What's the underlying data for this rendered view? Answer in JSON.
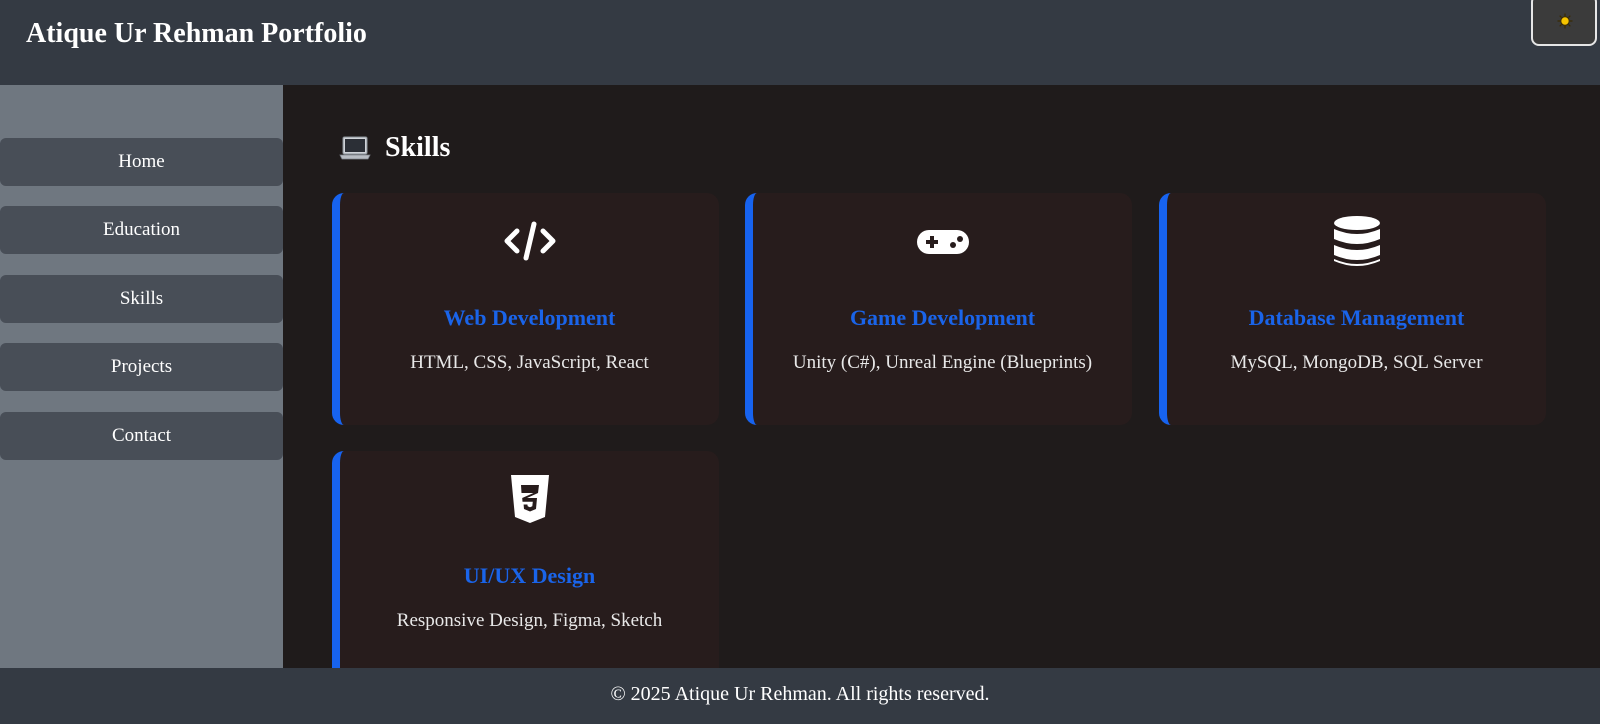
{
  "header": {
    "title": "Atique Ur Rehman Portfolio",
    "theme_toggle_icon": "sun-icon"
  },
  "sidebar": {
    "items": [
      {
        "label": "Home"
      },
      {
        "label": "Education"
      },
      {
        "label": "Skills"
      },
      {
        "label": "Projects"
      },
      {
        "label": "Contact"
      }
    ]
  },
  "main": {
    "section_icon": "laptop-icon",
    "section_title": "Skills",
    "cards": [
      {
        "icon": "code-icon",
        "title": "Web Development",
        "text": "HTML, CSS, JavaScript, React"
      },
      {
        "icon": "gamepad-icon",
        "title": "Game Development",
        "text": "Unity (C#), Unreal Engine (Blueprints)"
      },
      {
        "icon": "database-icon",
        "title": "Database Management",
        "text": "MySQL, MongoDB, SQL Server"
      },
      {
        "icon": "css3-icon",
        "title": "UI/UX Design",
        "text": "Responsive Design, Figma, Sketch"
      }
    ]
  },
  "footer": {
    "text": "© 2025 Atique Ur Rehman. All rights reserved."
  },
  "colors": {
    "header_bg": "#343a43",
    "sidebar_bg": "#6f7780",
    "nav_item_bg": "#484e57",
    "main_bg": "#1f1b1b",
    "card_bg": "#271c1c",
    "accent": "#1763ef"
  }
}
